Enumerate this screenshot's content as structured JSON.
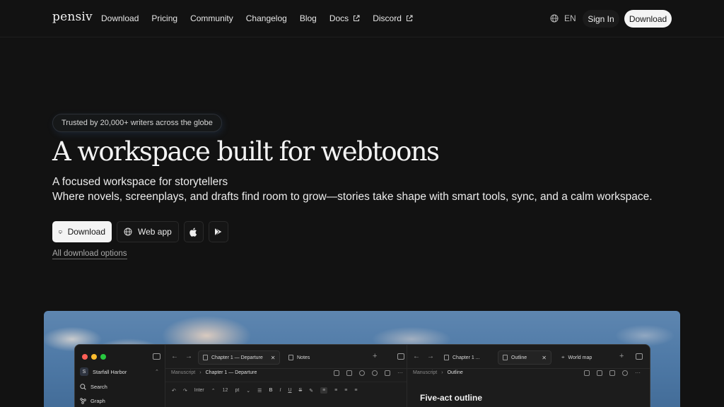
{
  "nav": {
    "logo": "pensiv",
    "links": [
      "Download",
      "Pricing",
      "Community",
      "Changelog",
      "Blog"
    ],
    "docs": "Docs",
    "discord": "Discord",
    "language": "EN",
    "signin": "Sign In",
    "download": "Download"
  },
  "hero": {
    "badge": "Trusted by 20,000+ writers across the globe",
    "headline": "A workspace built for webtoons",
    "subhead1": "A focused workspace for storytellers",
    "subhead2": "Where novels, screenplays, and drafts find room to grow—stories take shape with smart tools, sync, and a calm workspace.",
    "download_button": "Download",
    "webapp_button": "Web app",
    "all_options": "All download options"
  },
  "app": {
    "workspace_initial": "S",
    "workspace_name": "Starfall Harbor",
    "sidebar": [
      "Search",
      "Graph"
    ],
    "left_tabs": [
      "Chapter 1 — Departure",
      "Notes"
    ],
    "left_crumbs": [
      "Manuscript",
      "Chapter 1 — Departure"
    ],
    "font": "Inter",
    "font_size": "12",
    "font_unit": "pt",
    "right_tabs": [
      "Chapter 1 ...",
      "Outline",
      "World map"
    ],
    "right_crumbs": [
      "Manuscript",
      "Outline"
    ],
    "outline_heading": "Five-act outline"
  },
  "colors": {
    "background": "#121212",
    "primary_button": "#f4f4f4",
    "traffic_red": "#ff5f57",
    "traffic_yellow": "#febc2e",
    "traffic_green": "#28c840"
  }
}
